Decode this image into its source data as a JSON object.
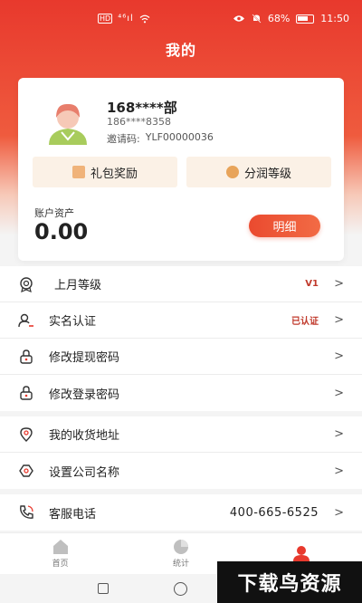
{
  "status_bar": {
    "left_icons": [
      "hd-icon",
      "signal-icon",
      "wifi-icon"
    ],
    "signal_text": "⁴⁶ıl",
    "battery": "68%",
    "time": "11:50"
  },
  "header": {
    "title": "我的"
  },
  "profile": {
    "name": "168****部",
    "phone": "186****8358",
    "invite_label": "邀请码:",
    "invite_code": "YLF00000036"
  },
  "actions": {
    "gift_label": "礼包奖励",
    "share_level_label": "分润等级"
  },
  "assets": {
    "label": "账户资产",
    "value": "0.00",
    "detail_button": "明细"
  },
  "menu_group_1": [
    {
      "label": "上月等级",
      "right": "V1",
      "icon": "badge-icon"
    },
    {
      "label": "实名认证",
      "right": "已认证",
      "icon": "user-check-icon"
    },
    {
      "label": "修改提现密码",
      "right": "",
      "icon": "lock-icon"
    },
    {
      "label": "修改登录密码",
      "right": "",
      "icon": "lock-icon"
    }
  ],
  "menu_group_2": [
    {
      "label": "我的收货地址",
      "icon": "location-icon"
    },
    {
      "label": "设置公司名称",
      "icon": "company-icon"
    }
  ],
  "menu_group_3": [
    {
      "label": "客服电话",
      "right": "400-665-6525",
      "icon": "phone-icon"
    }
  ],
  "tabbar": [
    {
      "label": "首页",
      "icon": "home-icon"
    },
    {
      "label": "统计",
      "icon": "pie-chart-icon"
    },
    {
      "label": "",
      "icon": "user-icon"
    }
  ],
  "watermark": "下载鸟资源",
  "colors": {
    "primary": "#e8392d",
    "accent_text": "#c0392b",
    "chip_bg": "#fbf1e6"
  }
}
